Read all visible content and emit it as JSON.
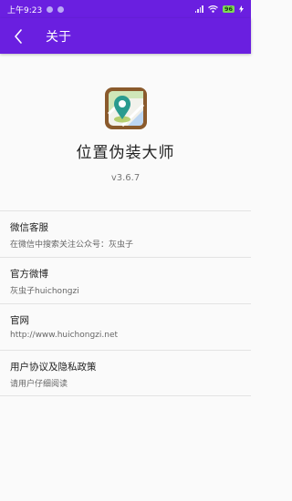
{
  "status": {
    "time": "上午9:23",
    "battery": "96"
  },
  "appbar": {
    "title": "关于"
  },
  "app": {
    "name": "位置伪装大师",
    "version": "v3.6.7"
  },
  "items": [
    {
      "title": "微信客服",
      "subtitle": "在微信中搜索关注公众号：灰虫子"
    },
    {
      "title": "官方微博",
      "subtitle": "灰虫子huichongzi"
    },
    {
      "title": "官网",
      "subtitle": "http://www.huichongzi.net"
    },
    {
      "title": "用户协议及隐私政策",
      "subtitle": "请用户仔细阅读"
    }
  ]
}
